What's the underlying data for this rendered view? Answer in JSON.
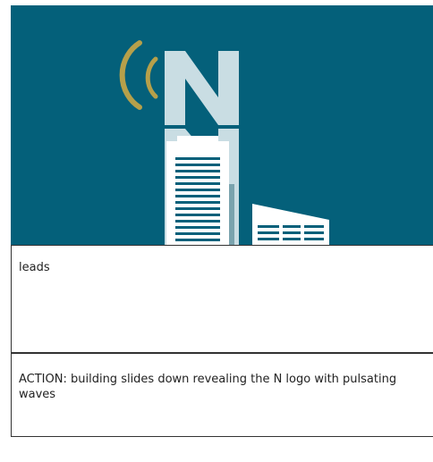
{
  "storyboard": {
    "frame": {
      "colors": {
        "background": "#04607a",
        "waves": "#b6a04a",
        "logo_letter": "#c9dde3",
        "building": "#ffffff",
        "windows": "#04607a"
      },
      "logo_letter": "N"
    },
    "leads_text": "leads",
    "action_text": "ACTION: building slides down revealing the N logo with pulsating waves"
  }
}
